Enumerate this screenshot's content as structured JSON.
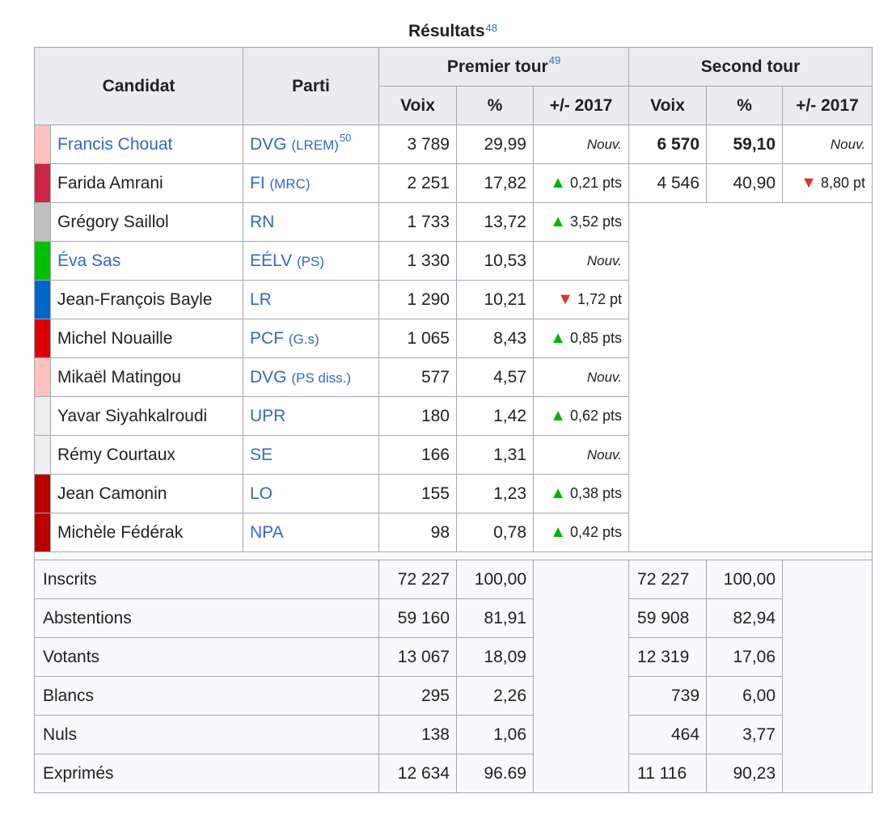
{
  "caption": {
    "title": "Résultats",
    "ref": "48"
  },
  "headers": {
    "candidat": "Candidat",
    "parti": "Parti",
    "premier_tour": "Premier tour",
    "premier_tour_ref": "49",
    "second_tour": "Second tour",
    "voix": "Voix",
    "pct": "%",
    "evo": "+/- 2017"
  },
  "candidates": [
    {
      "color": "#ffc0c0",
      "name": "Francis Chouat",
      "name_link": true,
      "party": "DVG",
      "party_sub": "(LREM)",
      "party_ref": "50",
      "voix1": "3 789",
      "pct1": "29,99",
      "evo1": "Nouv.",
      "trend1": "",
      "voix2": "6 570",
      "pct2": "59,10",
      "evo2": "Nouv.",
      "trend2": "",
      "bold2": true
    },
    {
      "color": "#cc2443",
      "name": "Farida Amrani",
      "name_link": false,
      "party": "FI",
      "party_sub": "(MRC)",
      "party_ref": "",
      "voix1": "2 251",
      "pct1": "17,82",
      "evo1": "0,21 pts",
      "trend1": "up",
      "voix2": "4 546",
      "pct2": "40,90",
      "evo2": "8,80 pt",
      "trend2": "down",
      "bold2": false
    },
    {
      "color": "#c0c0c0",
      "name": "Grégory Saillol",
      "name_link": false,
      "party": "RN",
      "party_sub": "",
      "party_ref": "",
      "voix1": "1 733",
      "pct1": "13,72",
      "evo1": "3,52 pts",
      "trend1": "up"
    },
    {
      "color": "#00c000",
      "name": "Éva Sas",
      "name_link": true,
      "party": "EÉLV",
      "party_sub": "(PS)",
      "party_ref": "",
      "voix1": "1 330",
      "pct1": "10,53",
      "evo1": "Nouv.",
      "trend1": ""
    },
    {
      "color": "#0066cc",
      "name": "Jean-François Bayle",
      "name_link": false,
      "party": "LR",
      "party_sub": "",
      "party_ref": "",
      "voix1": "1 290",
      "pct1": "10,21",
      "evo1": "1,72 pt",
      "trend1": "down"
    },
    {
      "color": "#dd0000",
      "name": "Michel Nouaille",
      "name_link": false,
      "party": "PCF",
      "party_sub": "(G.s)",
      "party_ref": "",
      "voix1": "1 065",
      "pct1": "8,43",
      "evo1": "0,85 pts",
      "trend1": "up"
    },
    {
      "color": "#ffc0c0",
      "name": "Mikaël Matingou",
      "name_link": false,
      "party": "DVG",
      "party_sub": "(PS diss.)",
      "party_ref": "",
      "voix1": "577",
      "pct1": "4,57",
      "evo1": "Nouv.",
      "trend1": ""
    },
    {
      "color": "#eeeeee",
      "name": "Yavar Siyahkalroudi",
      "name_link": false,
      "party": "UPR",
      "party_sub": "",
      "party_ref": "",
      "voix1": "180",
      "pct1": "1,42",
      "evo1": "0,62 pts",
      "trend1": "up"
    },
    {
      "color": "#eeeeee",
      "name": "Rémy Courtaux",
      "name_link": false,
      "party": "SE",
      "party_sub": "",
      "party_ref": "",
      "voix1": "166",
      "pct1": "1,31",
      "evo1": "Nouv.",
      "trend1": ""
    },
    {
      "color": "#bb0000",
      "name": "Jean Camonin",
      "name_link": false,
      "party": "LO",
      "party_sub": "",
      "party_ref": "",
      "voix1": "155",
      "pct1": "1,23",
      "evo1": "0,38 pts",
      "trend1": "up"
    },
    {
      "color": "#bb0000",
      "name": "Michèle Fédérak",
      "name_link": false,
      "party": "NPA",
      "party_sub": "",
      "party_ref": "",
      "voix1": "98",
      "pct1": "0,78",
      "evo1": "0,42 pts",
      "trend1": "up"
    }
  ],
  "totals": [
    {
      "label": "Inscrits",
      "voix1": "72 227",
      "pct1": "100,00",
      "voix2": "72 227",
      "pct2": "100,00",
      "align": "left"
    },
    {
      "label": "Abstentions",
      "voix1": "59 160",
      "pct1": "81,91",
      "voix2": "59 908",
      "pct2": "82,94",
      "align": "left"
    },
    {
      "label": "Votants",
      "voix1": "13 067",
      "pct1": "18,09",
      "voix2": "12 319",
      "pct2": "17,06",
      "align": "left"
    },
    {
      "label": "Blancs",
      "voix1": "295",
      "pct1": "2,26",
      "voix2": "739",
      "pct2": "6,00",
      "align": "right"
    },
    {
      "label": "Nuls",
      "voix1": "138",
      "pct1": "1,06",
      "voix2": "464",
      "pct2": "3,77",
      "align": "right"
    },
    {
      "label": "Exprimés",
      "voix1": "12 634",
      "pct1": "96.69",
      "voix2": "11 116",
      "pct2": "90,23",
      "align": "left"
    }
  ]
}
